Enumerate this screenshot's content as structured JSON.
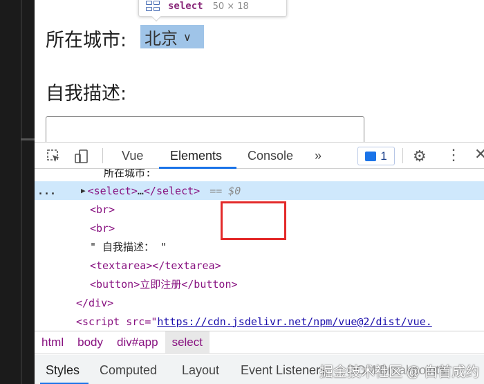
{
  "page": {
    "tooltip": {
      "tag": "select",
      "dims": "50 × 18"
    },
    "city_label": "所在城市:",
    "city_select_value": "北京",
    "desc_label": "自我描述:"
  },
  "devtools": {
    "tabs": [
      "Vue",
      "Elements",
      "Console",
      "»"
    ],
    "active_tab": "Elements",
    "issues_count": "1",
    "dom_lines": {
      "partial": "所在城市:",
      "select_open": "<select>",
      "select_ellipsis": "…",
      "select_close": "</select>",
      "eq": "== $0",
      "br1": "<br>",
      "br2": "<br>",
      "text_node": "\" 自我描述： \"",
      "textarea": "<textarea></textarea>",
      "button": "<button>立即注册</button>",
      "div_close": "</div>",
      "script_prefix": "<script src=\"",
      "script_url": "https://cdn.jsdelivr.net/npm/vue@2/dist/vue.",
      "more": "..."
    },
    "breadcrumbs": [
      "html",
      "body",
      "div#app",
      "select"
    ],
    "active_breadcrumb": "select",
    "subtabs": [
      "Styles",
      "Computed",
      "Layout",
      "Event Listeners",
      "DOM Breakpoints"
    ],
    "active_subtab": "Styles"
  },
  "watermark": "掘金技术社区 @ 白首成约",
  "colors": {
    "accent": "#1a73e8",
    "selection": "#cfe8fc",
    "select_highlight": "#9fc4e8",
    "tag": "#881280",
    "annotation_box": "#e32a2a"
  }
}
